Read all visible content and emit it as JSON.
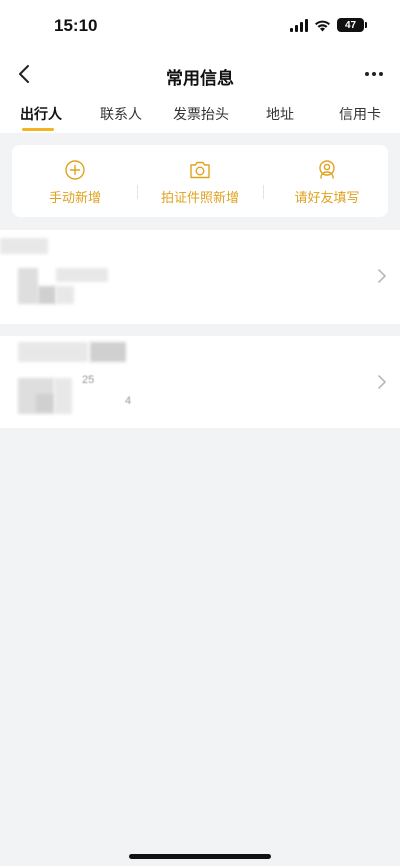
{
  "status_bar": {
    "time": "15:10",
    "battery": "47"
  },
  "nav": {
    "title": "常用信息"
  },
  "tabs": [
    {
      "label": "出行人",
      "active": true
    },
    {
      "label": "联系人",
      "active": false
    },
    {
      "label": "发票抬头",
      "active": false
    },
    {
      "label": "地址",
      "active": false
    },
    {
      "label": "信用卡",
      "active": false
    }
  ],
  "quick_actions": [
    {
      "label": "手动新增",
      "icon": "plus-circle-icon"
    },
    {
      "label": "拍证件照新增",
      "icon": "camera-icon"
    },
    {
      "label": "请好友填写",
      "icon": "friend-icon"
    }
  ],
  "travelers": [
    {
      "name": "",
      "id_partial": "",
      "phone_partial": ""
    },
    {
      "name": "",
      "id_partial": "25",
      "phone_partial": "4"
    }
  ],
  "colors": {
    "accent": "#f5b41f",
    "action_text": "#e0a21e",
    "background": "#f2f3f5"
  }
}
